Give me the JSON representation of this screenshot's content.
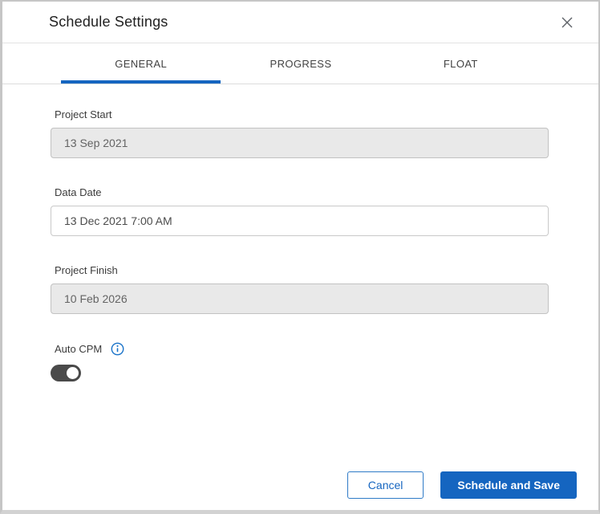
{
  "dialog": {
    "title": "Schedule Settings"
  },
  "icons": {
    "close": "x-mark",
    "info": "info-circle"
  },
  "tabs": [
    {
      "label": "GENERAL",
      "active": true
    },
    {
      "label": "PROGRESS",
      "active": false
    },
    {
      "label": "FLOAT",
      "active": false
    }
  ],
  "fields": [
    {
      "label": "Project Start",
      "value": "13 Sep 2021",
      "editable": false
    },
    {
      "label": "Data Date",
      "value": "13 Dec 2021 7:00 AM",
      "editable": true
    },
    {
      "label": "Project Finish",
      "value": "10 Feb 2026",
      "editable": false
    }
  ],
  "auto_cpm": {
    "label": "Auto CPM",
    "enabled": true
  },
  "footer": {
    "cancel_label": "Cancel",
    "primary_label": "Schedule and Save"
  },
  "colors": {
    "accent-blue": "#1565c0",
    "primary-button": "#1565c0",
    "toggle-track": "#4a4a4a",
    "disabled-input-bg": "#e9e9e9",
    "input-border": "#c9c9c9"
  }
}
